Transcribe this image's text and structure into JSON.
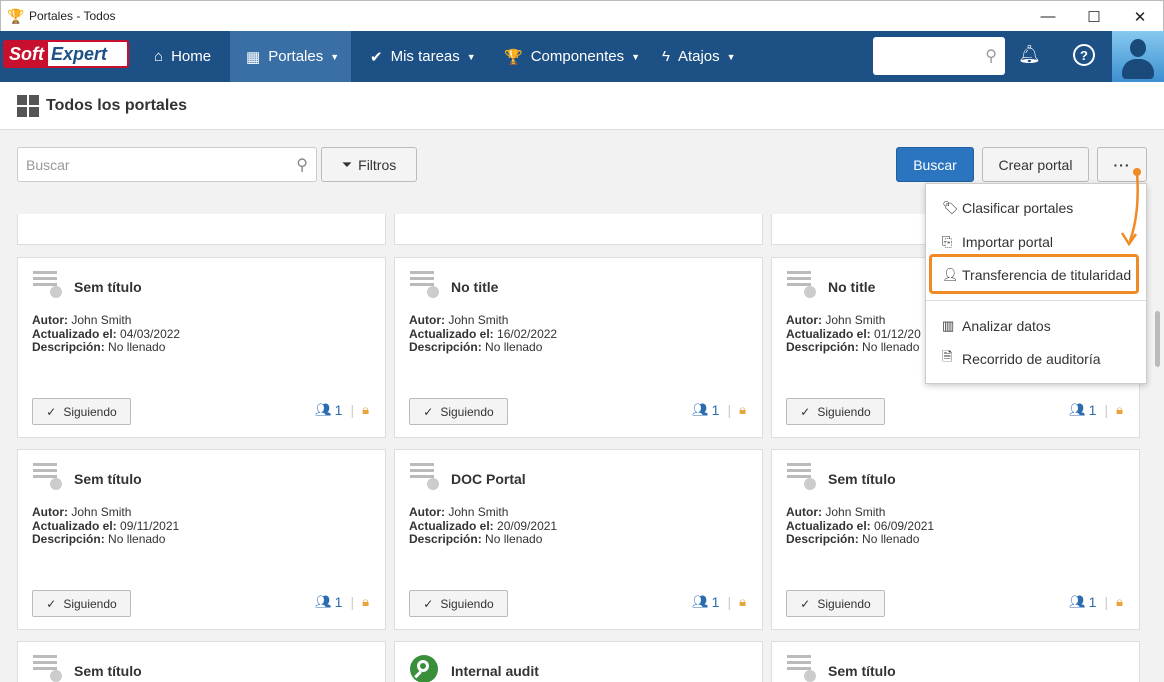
{
  "window": {
    "title": "Portales - Todos",
    "controls": [
      "—",
      "☐",
      "✕"
    ]
  },
  "brand": {
    "part1": "Soft",
    "part2": "Expert"
  },
  "nav": {
    "home": "Home",
    "portales": "Portales",
    "mis_tareas": "Mis tareas",
    "componentes": "Componentes",
    "atajos": "Atajos"
  },
  "page": {
    "title": "Todos los portales"
  },
  "toolbar": {
    "search_placeholder": "Buscar",
    "filters_label": "Filtros",
    "search_button": "Buscar",
    "create_button": "Crear portal",
    "more_button": "···"
  },
  "menu": {
    "items": [
      {
        "label": "Clasificar portales",
        "icon": "tag-icon"
      },
      {
        "label": "Importar portal",
        "icon": "import-icon"
      },
      {
        "label": "Transferencia de titularidad",
        "icon": "user-transfer-icon"
      },
      {
        "label": "Analizar datos",
        "icon": "chart-icon"
      },
      {
        "label": "Recorrido de auditoría",
        "icon": "audit-trail-icon"
      }
    ],
    "highlight_color": "#f08a24"
  },
  "card_labels": {
    "author": "Autor:",
    "updated": "Actualizado el:",
    "description": "Descripción:",
    "follow": "Siguiendo"
  },
  "cards": [
    {
      "title": "",
      "author": "",
      "updated": "",
      "description": "",
      "members": "1"
    },
    {
      "title": "",
      "author": "",
      "updated": "",
      "description": "",
      "members": "1"
    },
    {
      "title": "",
      "author": "",
      "updated": "",
      "description": "",
      "members": "1"
    },
    {
      "title": "Sem título",
      "author": "John Smith",
      "updated": "04/03/2022",
      "description": "No llenado",
      "members": "1"
    },
    {
      "title": "No title",
      "author": "John Smith",
      "updated": "16/02/2022",
      "description": "No llenado",
      "members": "1"
    },
    {
      "title": "No title",
      "author": "John Smith",
      "updated": "01/12/20",
      "description": "No llenado",
      "members": "1"
    },
    {
      "title": "Sem título",
      "author": "John Smith",
      "updated": "09/11/2021",
      "description": "No llenado",
      "members": "1"
    },
    {
      "title": "DOC Portal",
      "author": "John Smith",
      "updated": "20/09/2021",
      "description": "No llenado",
      "members": "1"
    },
    {
      "title": "Sem título",
      "author": "John Smith",
      "updated": "06/09/2021",
      "description": "No llenado",
      "members": "1"
    },
    {
      "title": "Sem título"
    },
    {
      "title": "Internal audit"
    },
    {
      "title": "Sem título"
    }
  ],
  "colors": {
    "nav_bg": "#1d5084",
    "primary": "#2b74c0",
    "accent": "#f08a24"
  }
}
